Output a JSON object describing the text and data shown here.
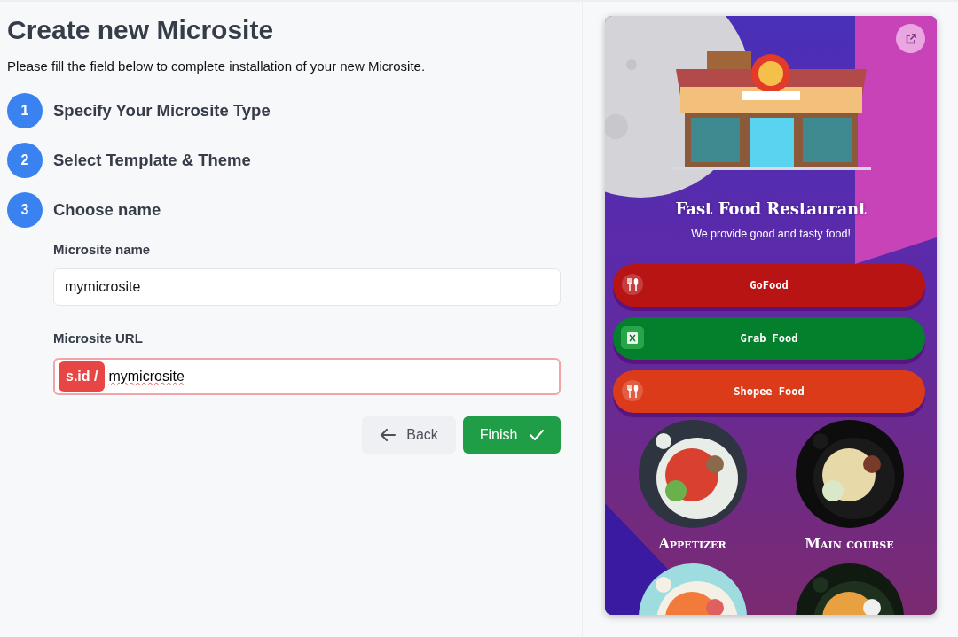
{
  "page": {
    "title": "Create new Microsite",
    "subtitle": "Please fill the field below to complete installation of your new Microsite."
  },
  "steps": [
    {
      "number": "1",
      "label": "Specify Your Microsite Type"
    },
    {
      "number": "2",
      "label": "Select Template & Theme"
    },
    {
      "number": "3",
      "label": "Choose name"
    }
  ],
  "fields": [
    {
      "kind": "text",
      "label": "Microsite name",
      "value": "mymicrosite"
    },
    {
      "kind": "prefixed",
      "label": "Microsite URL",
      "prefix": "s.id /",
      "value": "mymicrosite",
      "invalid": true
    }
  ],
  "buttons": [
    {
      "kind": "back",
      "label": "Back"
    },
    {
      "kind": "finish",
      "label": "Finish"
    }
  ],
  "preview": {
    "title": "Fast Food Restaurant",
    "tagline": "We provide good and tasty food!",
    "links": [
      {
        "kind": "utensils",
        "label": "GoFood",
        "color": "#b91414"
      },
      {
        "kind": "bag",
        "label": "Grab Food",
        "color": "#047f2c"
      },
      {
        "kind": "utensils",
        "label": "Shopee Food",
        "color": "#dc3b1a"
      }
    ],
    "menu": [
      {
        "kind": "dish",
        "label": "Appetizer"
      },
      {
        "kind": "dish",
        "label": "Main course"
      },
      {
        "kind": "picture"
      },
      {
        "kind": "picture"
      }
    ]
  }
}
